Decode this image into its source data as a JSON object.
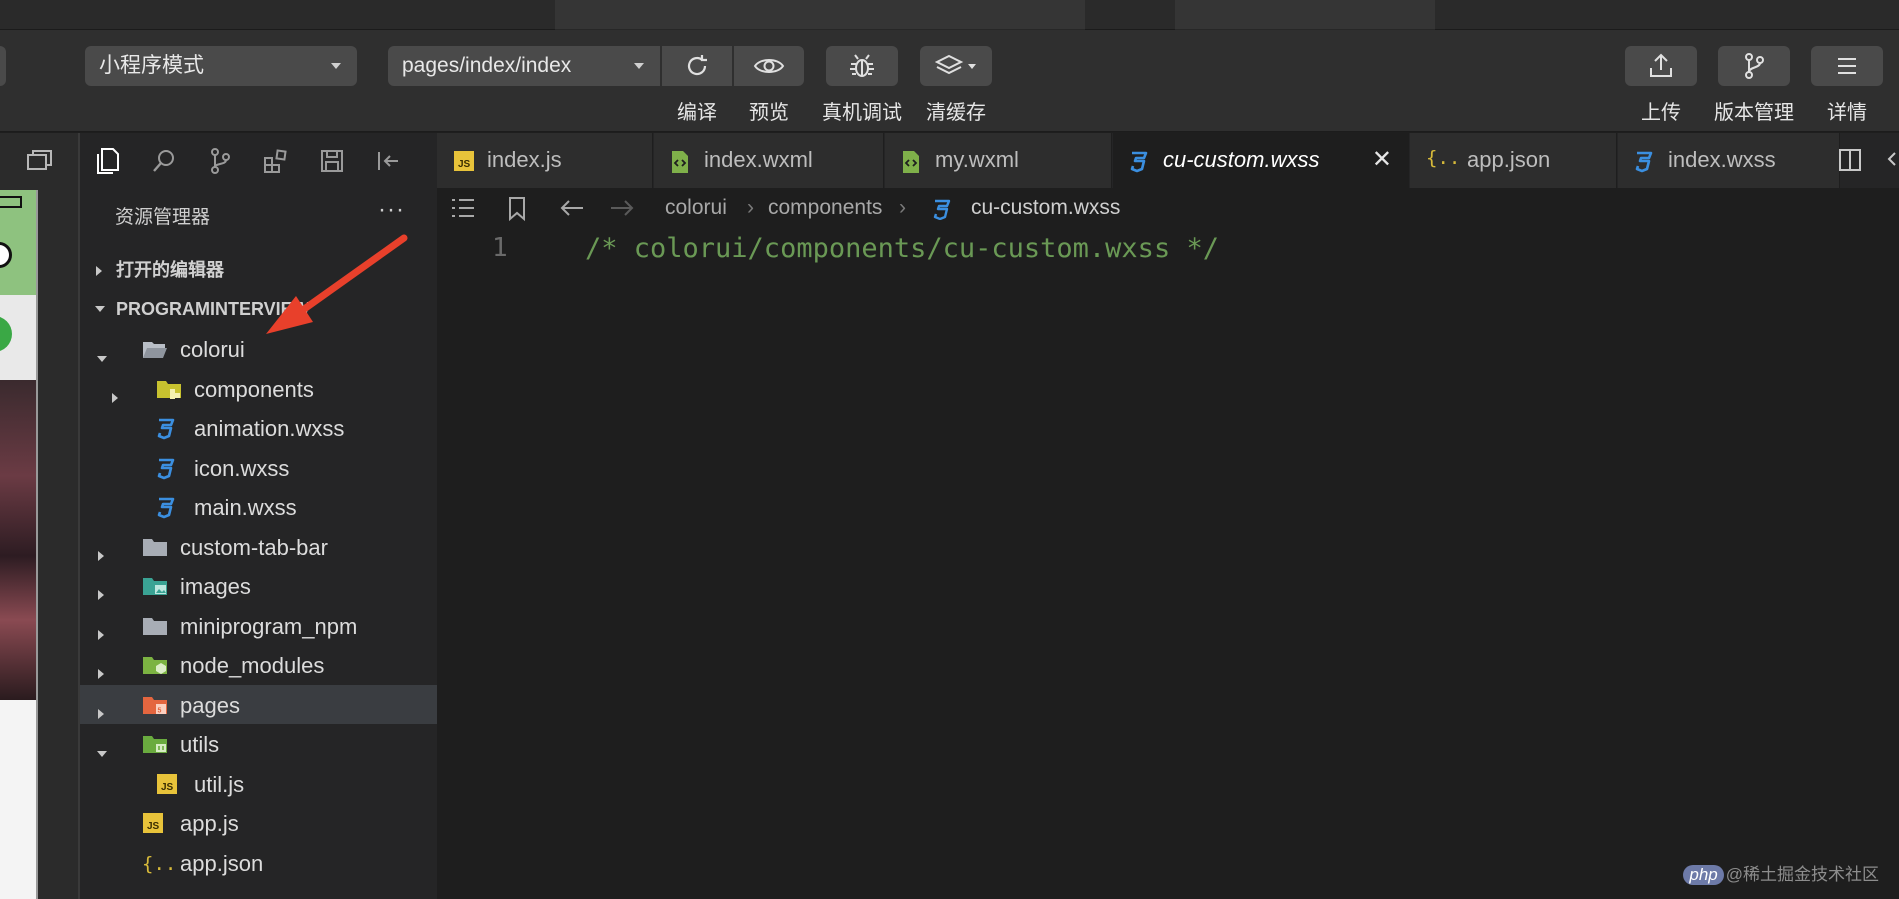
{
  "toolbar": {
    "mode_select": "小程序模式",
    "page_select": "pages/index/index",
    "compile_label": "编译",
    "preview_label": "预览",
    "debug_label": "真机调试",
    "clear_cache_label": "清缓存",
    "upload_label": "上传",
    "version_label": "版本管理",
    "details_label": "详情"
  },
  "sidebar": {
    "title": "资源管理器",
    "more": "···",
    "open_editors": "打开的编辑器",
    "project": "PROGRAMINTERVIEW",
    "tree": [
      {
        "name": "colorui",
        "indent": 1,
        "kind": "folder-open",
        "expanded": true
      },
      {
        "name": "components",
        "indent": 2,
        "kind": "folder-components",
        "expanded": false
      },
      {
        "name": "animation.wxss",
        "indent": 2,
        "kind": "css"
      },
      {
        "name": "icon.wxss",
        "indent": 2,
        "kind": "css"
      },
      {
        "name": "main.wxss",
        "indent": 2,
        "kind": "css"
      },
      {
        "name": "custom-tab-bar",
        "indent": 1,
        "kind": "folder",
        "expanded": false
      },
      {
        "name": "images",
        "indent": 1,
        "kind": "folder-images",
        "expanded": false
      },
      {
        "name": "miniprogram_npm",
        "indent": 1,
        "kind": "folder",
        "expanded": false
      },
      {
        "name": "node_modules",
        "indent": 1,
        "kind": "folder-node",
        "expanded": false
      },
      {
        "name": "pages",
        "indent": 1,
        "kind": "folder-pages",
        "expanded": false,
        "active": true
      },
      {
        "name": "utils",
        "indent": 1,
        "kind": "folder-utils",
        "expanded": true
      },
      {
        "name": "util.js",
        "indent": 2,
        "kind": "js"
      },
      {
        "name": "app.js",
        "indent": 1,
        "kind": "js"
      },
      {
        "name": "app.json",
        "indent": 1,
        "kind": "json"
      }
    ]
  },
  "tabs": [
    {
      "label": "index.js",
      "kind": "js",
      "active": false
    },
    {
      "label": "index.wxml",
      "kind": "wxml",
      "active": false
    },
    {
      "label": "my.wxml",
      "kind": "wxml",
      "active": false
    },
    {
      "label": "cu-custom.wxss",
      "kind": "css",
      "active": true
    },
    {
      "label": "app.json",
      "kind": "json",
      "active": false
    },
    {
      "label": "index.wxss",
      "kind": "css",
      "active": false
    }
  ],
  "breadcrumb": {
    "part1": "colorui",
    "part2": "components",
    "file": "cu-custom.wxss"
  },
  "editor": {
    "line_number": "1",
    "line_text": "/* colorui/components/cu-custom.wxss */"
  },
  "watermark": {
    "badge": "php",
    "text": "@稀土掘金技术社区"
  },
  "colors": {
    "js_icon": "#e8c33a",
    "css_icon": "#3b8fe0",
    "wxml_icon": "#7fb04a",
    "json_icon": "#d7ba3a",
    "comment": "#6a9955",
    "arrow": "#e8402b"
  }
}
